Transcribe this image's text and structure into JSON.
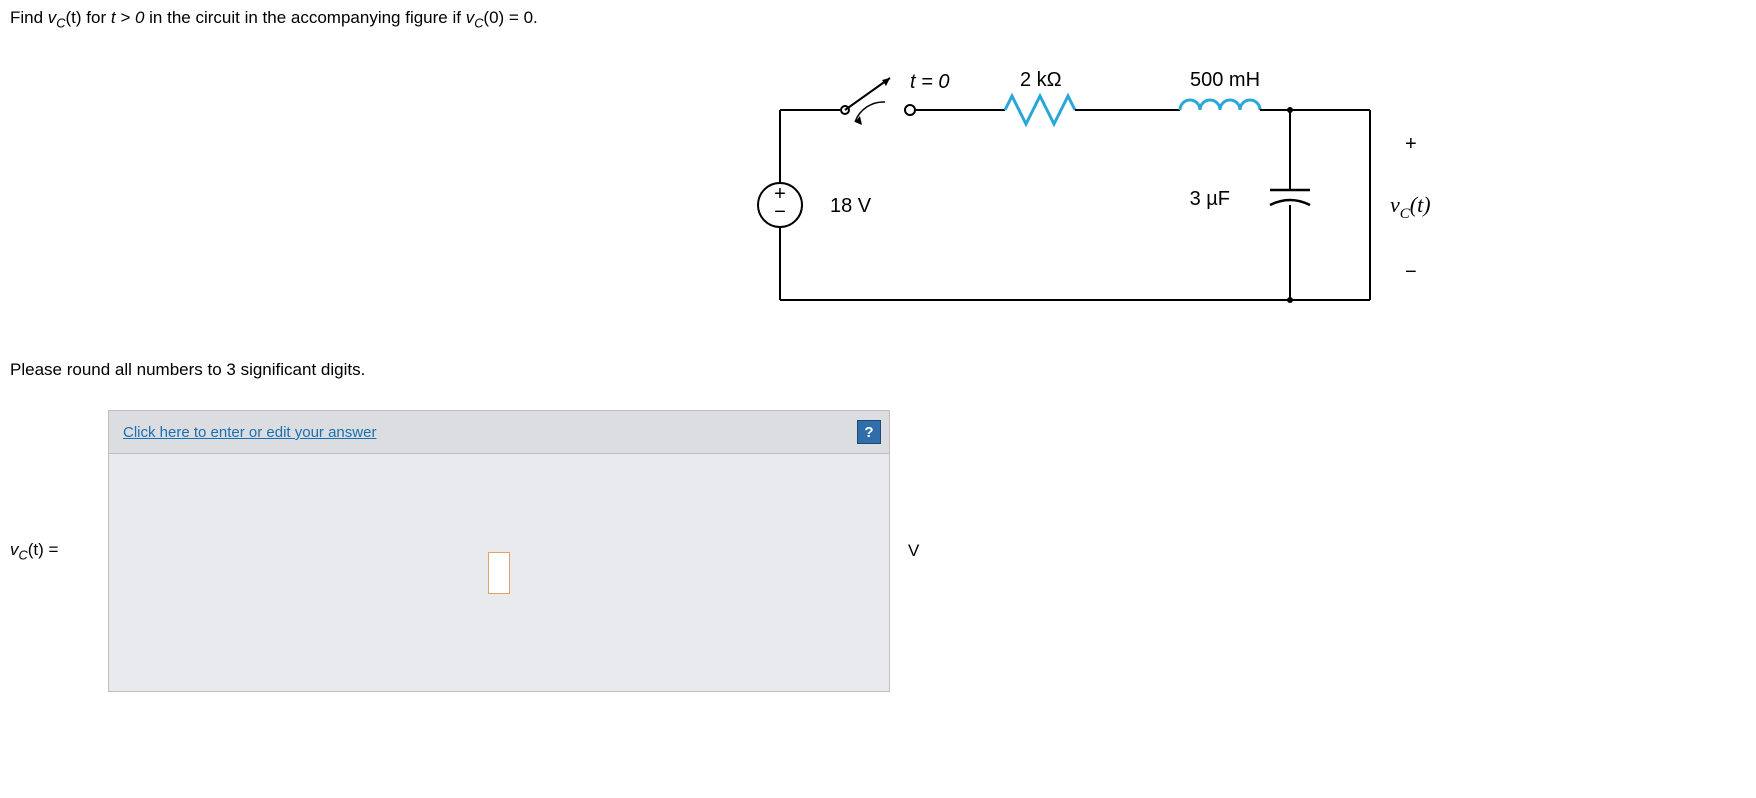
{
  "question": {
    "prefix": "Find ",
    "var_v": "v",
    "sub_C": "C",
    "paren_t": "(t)",
    "mid1": " for ",
    "tgt": "t > 0",
    "mid2": " in the circuit in the accompanying figure if ",
    "vc0": "(0) = 0."
  },
  "circuit": {
    "switch_label": "t = 0",
    "resistor": "2 kΩ",
    "inductor": "500 mH",
    "source": "18 V",
    "capacitor": "3 µF",
    "vc": "v",
    "vc_sub": "C",
    "vc_t": "(t)",
    "plus": "+",
    "minus": "−"
  },
  "instruction": "Please round all numbers to 3 significant digits.",
  "answer": {
    "label_v": "v",
    "label_sub": "C",
    "label_t": "(t) =",
    "link": "Click here to enter or edit your answer",
    "help": "?",
    "unit": "V"
  }
}
